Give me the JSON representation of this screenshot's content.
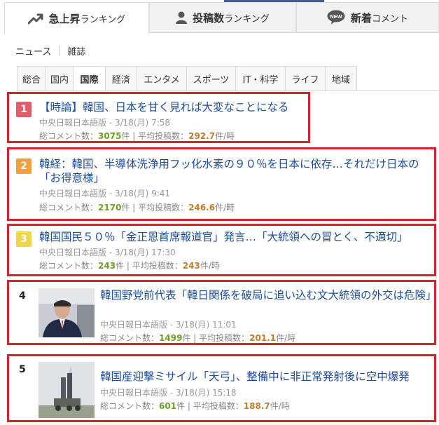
{
  "colors": {
    "rank1": "#e25c6a",
    "rank2": "#f0a040",
    "rank3": "#f2d34c",
    "highlight_border": "#d6222a",
    "link": "#1a4da0"
  },
  "main_tabs": [
    {
      "label": "急上昇",
      "label_small": "ランキング",
      "icon": "trend-up-icon",
      "active": true
    },
    {
      "label": "投稿数",
      "label_small": "ランキング",
      "icon": "user-icon",
      "active": false
    },
    {
      "label": "新着",
      "label_small": "コメント",
      "icon": "new-badge-icon",
      "badge_text": "NEW",
      "active": false
    }
  ],
  "subnav": {
    "news_label": "ニュース",
    "magazine_label": "雑誌"
  },
  "category_tabs": [
    "総合",
    "国内",
    "国際",
    "経済",
    "エンタメ",
    "スポーツ",
    "IT・科学",
    "ライフ",
    "地域"
  ],
  "active_category": "国際",
  "stats_labels": {
    "total_label": "総コメント数：",
    "count_unit": "件",
    "avg_label": "平均投稿数：",
    "avg_unit": "件/時"
  },
  "items": [
    {
      "rank": "1",
      "title": "【時論】韓国、日本を甘く見れば大変なことになる",
      "source": "中央日報日本語版 - 3/18(月) 7:58",
      "total": "3075",
      "avg": "292.7"
    },
    {
      "rank": "2",
      "title": "韓経：韓国、半導体洗浄用フッ化水素の９０％を日本に依存…それだけ日本の「お得意様」",
      "source": "中央日報日本語版 - 3/18(月) 9:41",
      "total": "2170",
      "avg": "246.6"
    },
    {
      "rank": "3",
      "title": "韓国国民５０％「金正恩首席報道官」発言…「大統領への冒とく、不適切」",
      "source": "中央日報日本語版 - 3/18(月) 17:30",
      "total": "243",
      "avg": "243"
    },
    {
      "rank": "4",
      "title": "韓国野党前代表「韓日関係を破局に追い込む文大統領の外交は危険」",
      "source": "中央日報日本語版 - 3/18(月) 11:01",
      "total": "1499",
      "avg": "201.1"
    },
    {
      "rank": "5",
      "title": "韓国産迎撃ミサイル「天弓」、整備中に非正常発射後に空中爆発",
      "source": "中央日報日本語版 - 3/18(月) 15:18",
      "total": "601",
      "avg": "188.7"
    }
  ]
}
